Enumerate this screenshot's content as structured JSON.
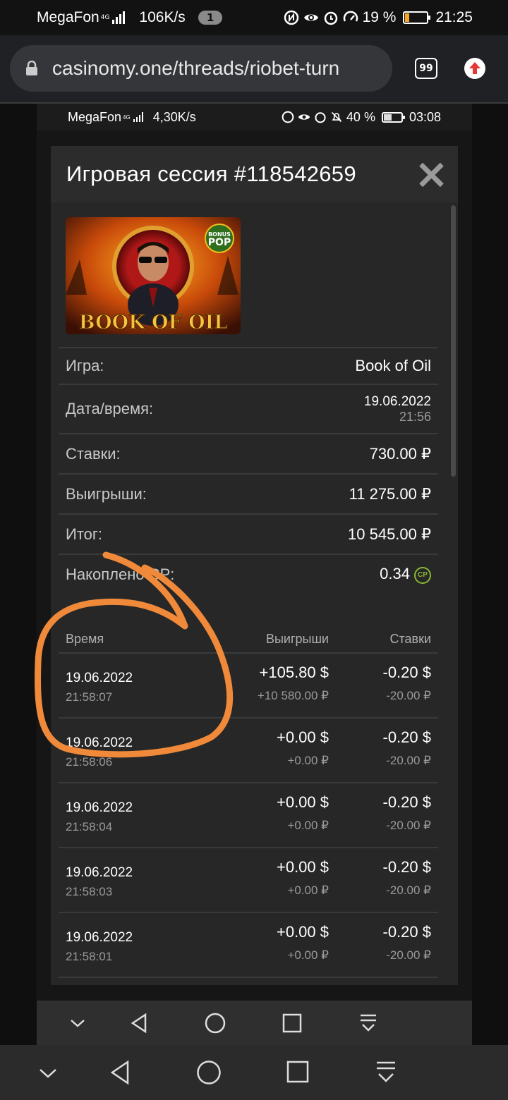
{
  "status_bar": {
    "carrier": "MegaFon",
    "network": "4G",
    "speed": "106K/s",
    "notification_count": "1",
    "battery": "19 %",
    "battery_level": 0.19,
    "time": "21:25"
  },
  "browser": {
    "url": "casinomy.one/threads/riobet-turn",
    "tab_count": "99"
  },
  "inner_status_bar": {
    "carrier": "MegaFon",
    "network": "4G",
    "speed": "4,30K/s",
    "battery": "40 %",
    "time": "03:08"
  },
  "modal": {
    "title": "Игровая сессия #118542659",
    "game_banner_text": "BOOK OF OIL",
    "game_badge": "BONUS POP",
    "info": [
      {
        "label": "Игра:",
        "value": "Book of Oil"
      },
      {
        "label": "Дата/время:",
        "value": "19.06.2022",
        "sub": "21:56"
      },
      {
        "label": "Ставки:",
        "value": "730.00 ₽"
      },
      {
        "label": "Выигрыши:",
        "value": "11 275.00 ₽"
      },
      {
        "label": "Итог:",
        "value": "10 545.00 ₽"
      },
      {
        "label": "Накоплено CP:",
        "value": "0.34",
        "badge": "CP"
      }
    ],
    "spins_headers": {
      "time": "Время",
      "wins": "Выигрыши",
      "bets": "Ставки"
    },
    "spins": [
      {
        "date": "19.06.2022",
        "time": "21:58:07",
        "win_usd": "+105.80 $",
        "win_rub": "+10 580.00 ₽",
        "bet_usd": "-0.20 $",
        "bet_rub": "-20.00 ₽"
      },
      {
        "date": "19.06.2022",
        "time": "21:58:06",
        "win_usd": "+0.00 $",
        "win_rub": "+0.00 ₽",
        "bet_usd": "-0.20 $",
        "bet_rub": "-20.00 ₽"
      },
      {
        "date": "19.06.2022",
        "time": "21:58:04",
        "win_usd": "+0.00 $",
        "win_rub": "+0.00 ₽",
        "bet_usd": "-0.20 $",
        "bet_rub": "-20.00 ₽"
      },
      {
        "date": "19.06.2022",
        "time": "21:58:03",
        "win_usd": "+0.00 $",
        "win_rub": "+0.00 ₽",
        "bet_usd": "-0.20 $",
        "bet_rub": "-20.00 ₽"
      },
      {
        "date": "19.06.2022",
        "time": "21:58:01",
        "win_usd": "+0.00 $",
        "win_rub": "+0.00 ₽",
        "bet_usd": "-0.20 $",
        "bet_rub": "-20.00 ₽"
      }
    ]
  },
  "colors": {
    "annotation": "#f08a3a",
    "cp_badge": "#8ab833",
    "battery_low": "#f5a623"
  }
}
